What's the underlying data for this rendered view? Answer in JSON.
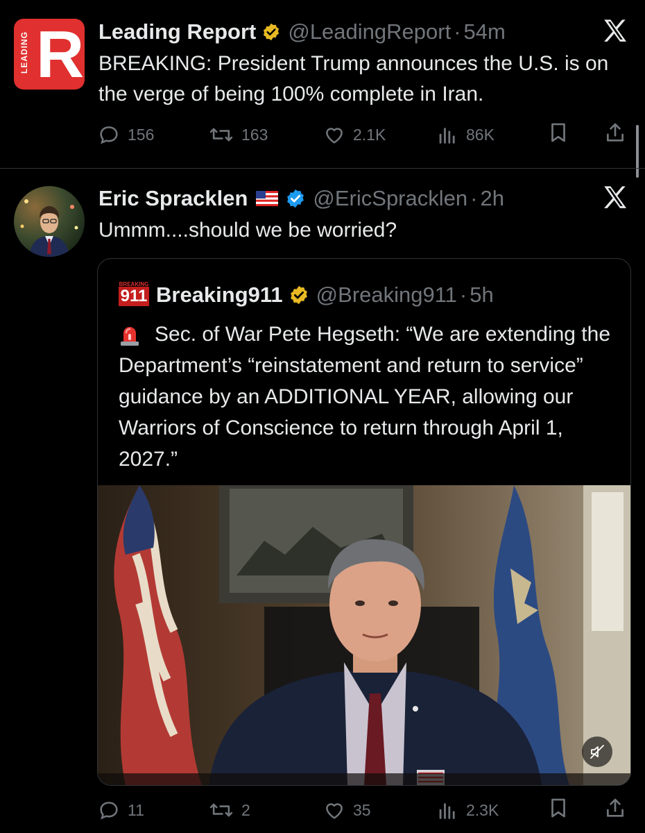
{
  "tweet1": {
    "display_name": "Leading Report",
    "handle": "@LeadingReport",
    "separator": "·",
    "time": "54m",
    "avatar_text": "LEADING",
    "avatar_letter": "R",
    "text": "BREAKING: President Trump announces the U.S. is on the verge of being 100% complete in Iran.",
    "replies": "156",
    "reposts": "163",
    "likes": "2.1K",
    "views": "86K",
    "brand_color": "#e0302f",
    "badge_color": "#e8b923"
  },
  "tweet2": {
    "display_name": "Eric Spracklen",
    "handle": "@EricSpracklen",
    "separator": "·",
    "time": "2h",
    "text": "Ummm....should we be worried?",
    "replies": "11",
    "reposts": "2",
    "likes": "35",
    "views": "2.3K",
    "badge_color": "#1d9bf0"
  },
  "quoted": {
    "logo_top": "BREAKING",
    "logo_main": "911",
    "display_name": "Breaking911",
    "handle": "@Breaking911",
    "separator": "·",
    "time": "5h",
    "text": "Sec. of War Pete Hegseth: “We are extending the Department’s “reinstatement and return to service” guidance by an ADDITIONAL YEAR, allowing our Warriors of Conscience to return through April 1, 2027.”",
    "emoji": "rotating-light-icon"
  },
  "icons": [
    "x-logo-icon",
    "reply-icon",
    "repost-icon",
    "like-icon",
    "views-icon",
    "bookmark-icon",
    "share-icon",
    "verified-gold-icon",
    "verified-blue-icon",
    "us-flag-icon",
    "mute-icon"
  ]
}
